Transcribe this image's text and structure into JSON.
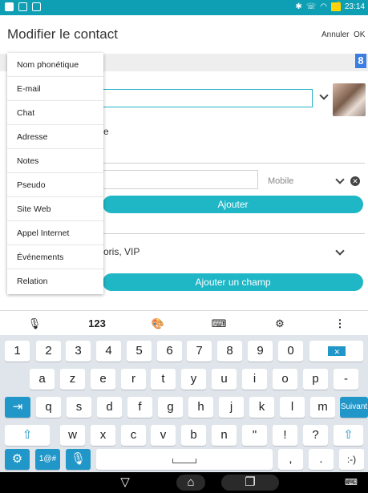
{
  "status": {
    "time": "23:14"
  },
  "header": {
    "title": "Modifier le contact",
    "cancel": "Annuler",
    "ok": "OK"
  },
  "form": {
    "account_badge": "8",
    "name_fragment": "e",
    "phone_type": "Mobile",
    "add_label": "Ajouter",
    "group_fragment": "oris, VIP",
    "add_field_label": "Ajouter un champ"
  },
  "popup": {
    "items": [
      "Nom phonétique",
      "E-mail",
      "Chat",
      "Adresse",
      "Notes",
      "Pseudo",
      "Site Web",
      "Appel Internet",
      "Événements",
      "Relation"
    ]
  },
  "toolbar": {
    "numbers": "123"
  },
  "keyboard": {
    "row1": [
      "1",
      "2",
      "3",
      "4",
      "5",
      "6",
      "7",
      "8",
      "9",
      "0"
    ],
    "row2": [
      "a",
      "z",
      "e",
      "r",
      "t",
      "y",
      "u",
      "i",
      "o",
      "p",
      "-"
    ],
    "row3": [
      "q",
      "s",
      "d",
      "f",
      "g",
      "h",
      "j",
      "k",
      "l",
      "m"
    ],
    "suivant": "Suivant",
    "row4": [
      "w",
      "x",
      "c",
      "v",
      "b",
      "n",
      "\"",
      "!",
      "?"
    ],
    "symbols": "1@#",
    "comma": ",",
    "period": ".",
    "smiley": ":-)"
  }
}
